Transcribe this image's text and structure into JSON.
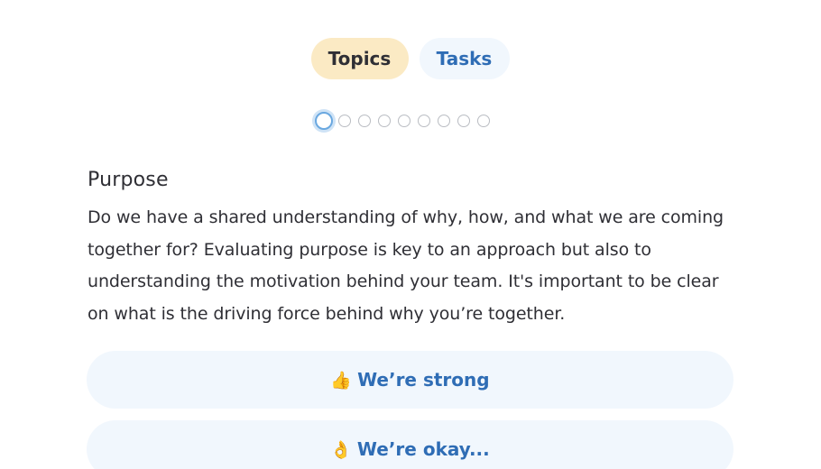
{
  "tabs": {
    "topics_label": "Topics",
    "tasks_label": "Tasks"
  },
  "pager": {
    "total": 9,
    "current": 1
  },
  "section": {
    "title": "Purpose",
    "description": "Do we have a shared understanding of why, how, and what we are coming together for? Evaluating purpose is key to an approach but also to understanding the motivation behind your team. It's important to be clear on what is the driving force behind why you’re together."
  },
  "answers": {
    "strong": {
      "emoji": "👍",
      "label": "We’re strong"
    },
    "okay": {
      "emoji": "👌",
      "label": "We’re okay..."
    }
  },
  "colors": {
    "topics_tab_bg": "#fbeac4",
    "tasks_tab_bg": "#f1f7fd",
    "accent_text": "#2f6db5",
    "answer_bg": "#f1f7fd"
  }
}
